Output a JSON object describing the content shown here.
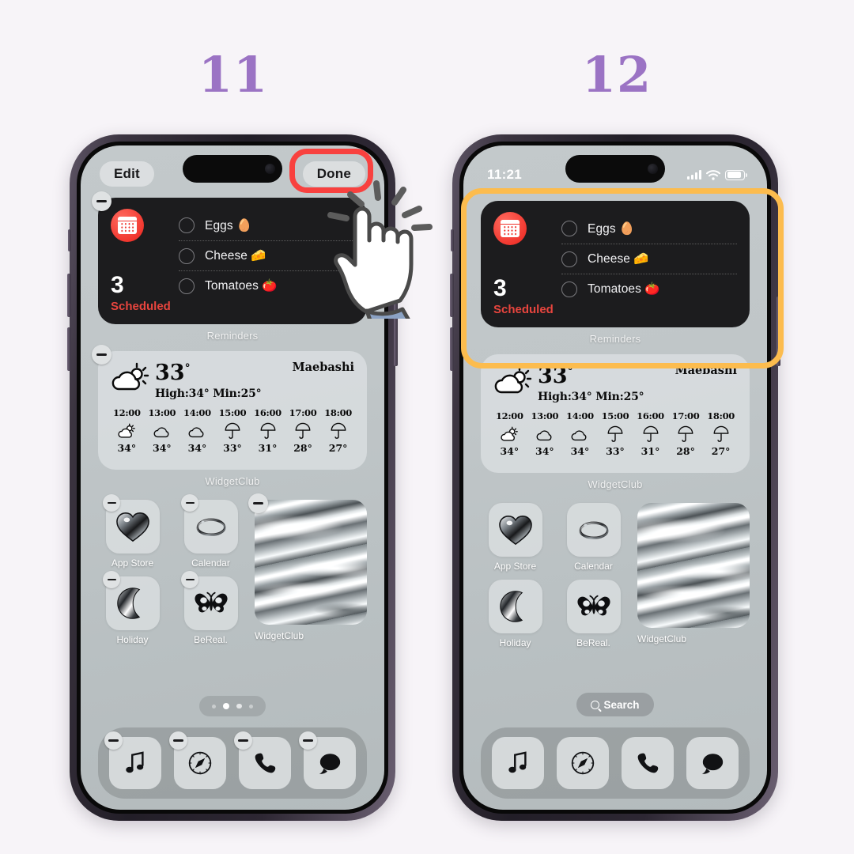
{
  "steps": {
    "left": "11",
    "right": "12"
  },
  "colors": {
    "background": "#f7f4f8",
    "step_number": "#9b73c4",
    "highlight_red": "#f8413f",
    "highlight_orange": "#fcbc4e",
    "reminders_accent": "#e8453e",
    "widget_dark": "#1c1c1e"
  },
  "left_phone": {
    "mode": "edit",
    "edit_bar": {
      "edit_label": "Edit",
      "done_label": "Done"
    },
    "page_dots": {
      "count": 4,
      "active_index": 1
    }
  },
  "right_phone": {
    "mode": "home",
    "status_bar": {
      "time": "11:21",
      "signal_icon": "signal-bars-icon",
      "wifi_icon": "wifi-icon",
      "battery_icon": "battery-icon"
    },
    "search_pill": {
      "label": "Search",
      "icon": "search-icon"
    }
  },
  "widgets": {
    "reminders": {
      "app_icon": "calendar-icon",
      "count": "3",
      "status": "Scheduled",
      "items": [
        {
          "text": "Eggs 🥚",
          "checked": false
        },
        {
          "text": "Cheese 🧀",
          "checked": false
        },
        {
          "text": "Tomatoes 🍅",
          "checked": false
        }
      ],
      "label": "Reminders"
    },
    "weather": {
      "temp": "33",
      "degree": "°",
      "high_low": "High:34° Min:25°",
      "city": "Maebashi",
      "condition_icon": "partly-cloudy-icon",
      "label": "WidgetClub",
      "hourly": [
        {
          "time": "12:00",
          "icon": "partly-cloudy-icon",
          "temp": "34°"
        },
        {
          "time": "13:00",
          "icon": "cloud-icon",
          "temp": "34°"
        },
        {
          "time": "14:00",
          "icon": "cloud-icon",
          "temp": "34°"
        },
        {
          "time": "15:00",
          "icon": "umbrella-icon",
          "temp": "33°"
        },
        {
          "time": "16:00",
          "icon": "umbrella-icon",
          "temp": "31°"
        },
        {
          "time": "17:00",
          "icon": "umbrella-icon",
          "temp": "28°"
        },
        {
          "time": "18:00",
          "icon": "umbrella-icon",
          "temp": "27°"
        }
      ]
    },
    "marble": {
      "label": "WidgetClub",
      "icon": "marble-texture-icon"
    }
  },
  "apps": [
    {
      "name": "App Store",
      "icon": "chrome-heart-icon"
    },
    {
      "name": "Calendar",
      "icon": "chrome-ring-icon"
    },
    {
      "name": "Holiday",
      "icon": "chrome-moon-icon"
    },
    {
      "name": "BeReal.",
      "icon": "butterfly-icon"
    }
  ],
  "dock": [
    {
      "name": "Music",
      "icon": "music-note-icon"
    },
    {
      "name": "Safari",
      "icon": "compass-icon"
    },
    {
      "name": "Phone",
      "icon": "phone-handset-icon"
    },
    {
      "name": "Messages",
      "icon": "message-bubble-icon"
    }
  ],
  "annotations": {
    "tap_cursor": "pointing-hand-cursor",
    "red_highlight_target": "Done",
    "orange_highlight_target": "Reminders"
  }
}
